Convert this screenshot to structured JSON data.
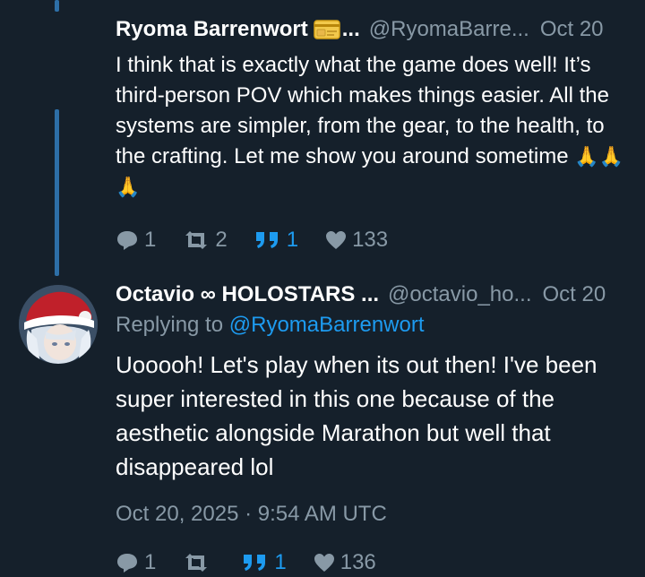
{
  "colors": {
    "background": "#15202b",
    "text_primary": "#ffffff",
    "text_secondary": "#8899a6",
    "accent": "#1d9bf0",
    "thread_line": "#2d6fa7"
  },
  "tweets": [
    {
      "display_name": "Ryoma Barrenwort",
      "badge_icon": "id-card-emoji",
      "name_ellipsis": "...",
      "handle": "@RyomaBarre...",
      "date": "Oct 20",
      "text": "I think that is exactly what the game does well! It’s third-person POV which makes things easier. All the systems are simpler, from the gear, to the health, to the crafting. Let me show you around sometime",
      "emoji": "🙏🙏🙏",
      "replies": "1",
      "retweets": "2",
      "quotes": "1",
      "likes": "133"
    },
    {
      "display_name": "Octavio ∞ HOLOSTARS ...",
      "handle": "@octavio_ho...",
      "date": "Oct 20",
      "reply_prefix": "Replying to",
      "reply_mention": "@RyomaBarrenwort",
      "text": "Uooooh! Let's play when its out then! I've been super interested in this one because of the aesthetic alongside Marathon but well that disappeared lol",
      "timestamp": "Oct 20, 2025 · 9:54 AM UTC",
      "replies": "1",
      "retweets": "",
      "quotes": "1",
      "likes": "136"
    }
  ]
}
